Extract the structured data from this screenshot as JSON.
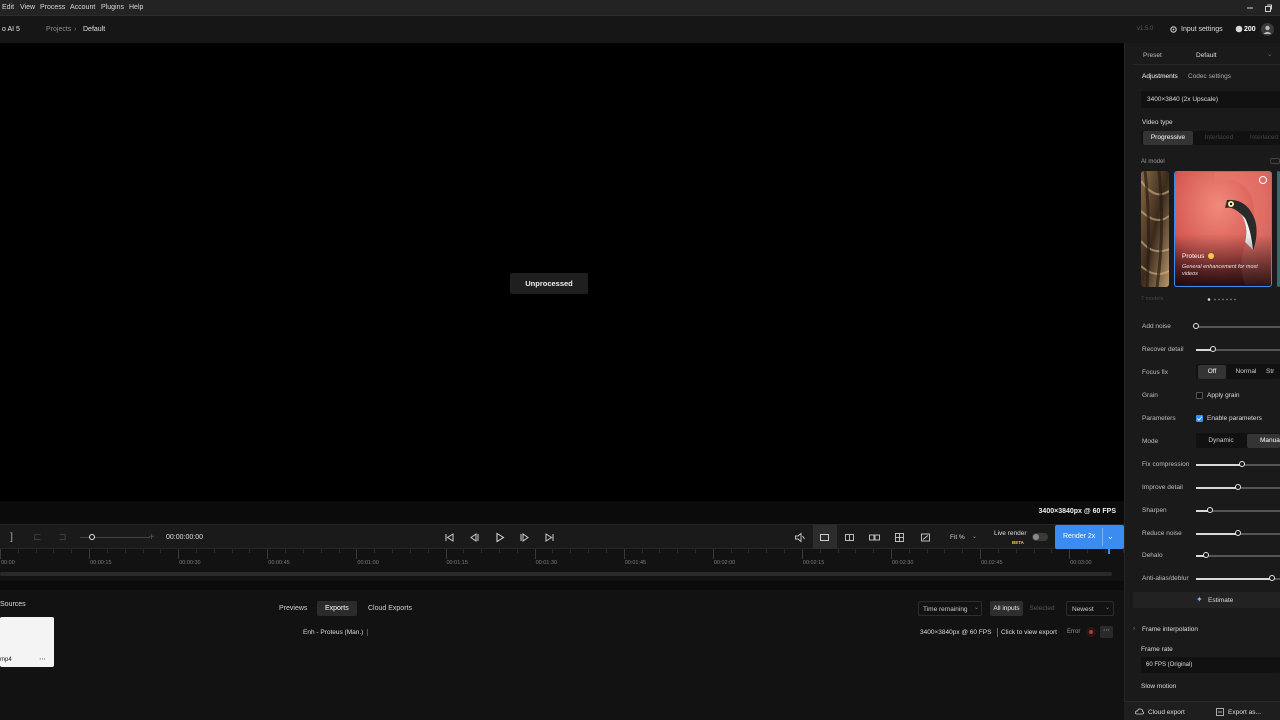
{
  "menubar": {
    "items": [
      "Edit",
      "View",
      "Process",
      "Account",
      "Plugins",
      "Help"
    ]
  },
  "app": {
    "title": "o AI 5",
    "breadcrumb": [
      "Projects",
      "Default"
    ],
    "version": "v1.5.0",
    "input_settings": "Input settings",
    "credits": "200"
  },
  "viewer": {
    "status": "Unprocessed",
    "output_info": "3400×3840px @ 60 FPS"
  },
  "transport": {
    "timecode": "00:00:00:00",
    "zoom": "Fit %",
    "live_render": "Live render",
    "live_badge": "BETA",
    "render_label": "Render 2x"
  },
  "timeline": {
    "labels": [
      "00:00",
      "00:00:15",
      "00:00:30",
      "00:00:45",
      "00:01:00",
      "00:01:15",
      "00:01:30",
      "00:01:45",
      "00:02:00",
      "00:02:15",
      "00:02:30",
      "00:02:45",
      "00:03:00"
    ]
  },
  "sources": {
    "title": "Sources",
    "file_name": "mp4",
    "more": "⋯"
  },
  "exports": {
    "tabs": [
      "Previews",
      "Exports",
      "Cloud Exports"
    ],
    "active_tab": "Exports",
    "sort": "Time remaining",
    "filter_all": "All inputs",
    "filter_selected": "Selected",
    "order": "Newest",
    "row": {
      "name": "Enh - Proteus (Man.)",
      "info": "3400×3840px @ 60 FPS",
      "action": "Click to view export",
      "status": "Error"
    }
  },
  "panel": {
    "preset_label": "Preset",
    "preset_value": "Default",
    "tabs": [
      "Adjustments",
      "Codec settings"
    ],
    "resolution": "3400×3840 (2x Upscale)",
    "video_type_label": "Video type",
    "video_types": [
      "Progressive",
      "Interlaced",
      "Interlaced"
    ],
    "ai_model_label": "AI model",
    "model_name": "Proteus",
    "model_desc": "General enhancement for most videos",
    "models_count": "7 models",
    "add_noise": {
      "label": "Add noise",
      "value": 0.0
    },
    "recover_detail": {
      "label": "Recover detail",
      "value": 0.2
    },
    "focus_fix": {
      "label": "Focus fix",
      "options": [
        "Off",
        "Normal",
        "Str"
      ],
      "selected": "Off"
    },
    "grain": {
      "label": "Grain",
      "check": "Apply grain",
      "checked": false
    },
    "parameters": {
      "label": "Parameters",
      "check": "Enable parameters",
      "checked": true
    },
    "mode": {
      "label": "Mode",
      "options": [
        "Dynamic",
        "Manua"
      ],
      "selected": "Manua"
    },
    "fix_compression": {
      "label": "Fix compression",
      "value": 0.55
    },
    "improve_detail": {
      "label": "Improve detail",
      "value": 0.5
    },
    "sharpen": {
      "label": "Sharpen",
      "value": 0.17
    },
    "reduce_noise": {
      "label": "Reduce noise",
      "value": 0.5
    },
    "dehalo": {
      "label": "Dehalo",
      "value": 0.12
    },
    "antialias": {
      "label": "Anti-alias/deblur",
      "value": 0.9
    },
    "estimate": "Estimate",
    "frame_interp": "Frame interpolation",
    "frame_rate_label": "Frame rate",
    "frame_rate_value": "60 FPS (Original)",
    "slow_motion": "Slow motion",
    "cloud_export": "Cloud export",
    "export_as": "Export as..."
  },
  "colors": {
    "accent": "#3a8cf0",
    "panel": "#1a1a1a",
    "badge": "#f2c94c",
    "error": "#b33a3a"
  }
}
